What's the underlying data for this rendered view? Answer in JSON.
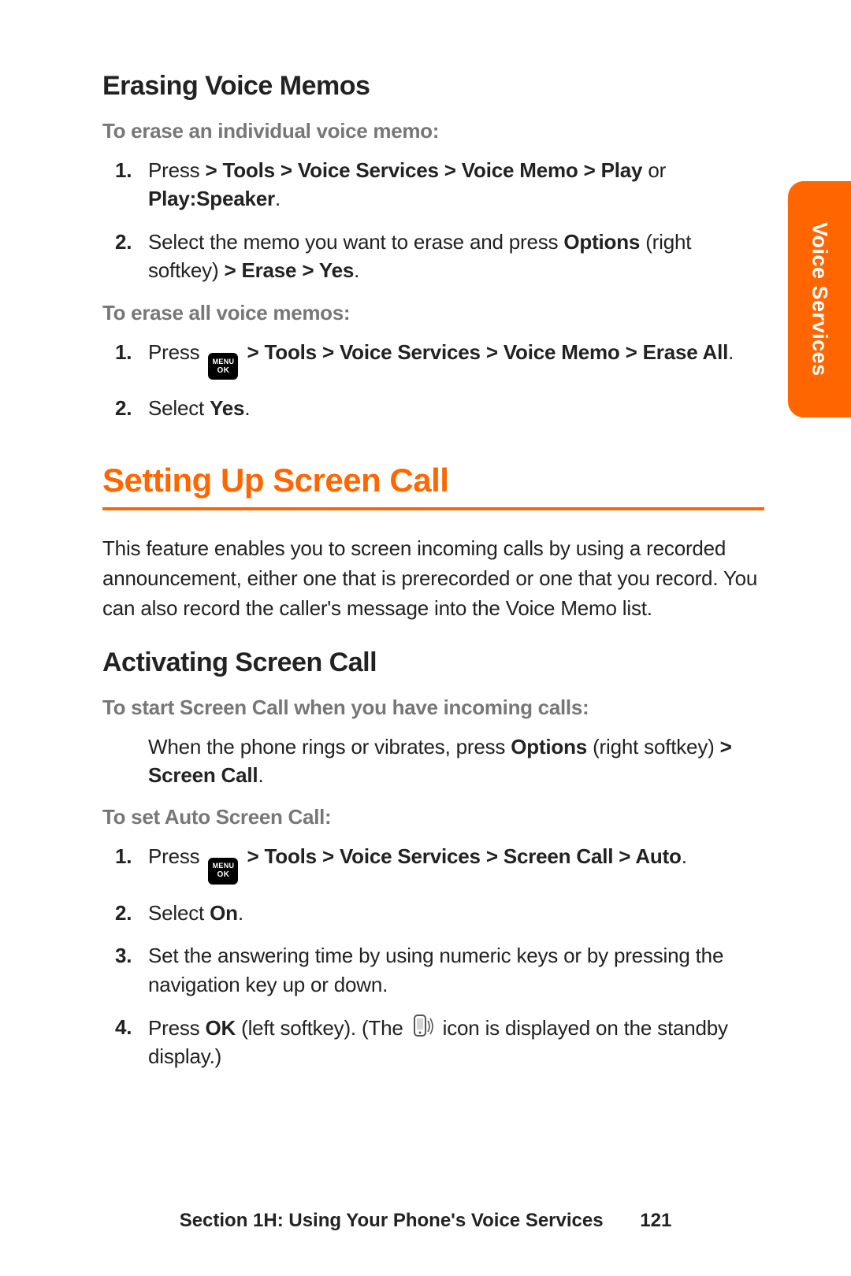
{
  "sideTab": "Voice Services",
  "h_erasing": "Erasing Voice Memos",
  "lead_erase_ind": "To erase an individual voice memo:",
  "erase_ind_steps": [
    {
      "num": "1.",
      "pre": "Press ",
      "bold1": "> Tools > Voice Services > Voice Memo > Play",
      "mid": " or ",
      "bold2": "Play:Speaker",
      "post": "."
    },
    {
      "num": "2.",
      "pre": "Select the memo you want to erase and press ",
      "bold1": "Options",
      "mid": " (right softkey) ",
      "bold2": "> Erase > Yes",
      "post": "."
    }
  ],
  "lead_erase_all": "To erase all voice memos:",
  "erase_all_steps": [
    {
      "num": "1.",
      "pre": "Press  ",
      "hasMenuIcon": true,
      "bold1": " > Tools > Voice Services > Voice Memo > Erase All",
      "post": "."
    },
    {
      "num": "2.",
      "pre": "Select ",
      "bold1": "Yes",
      "post": "."
    }
  ],
  "section_title": "Setting Up Screen Call",
  "intro": "This feature enables you to screen incoming calls by using a recorded announcement, either one that is prerecorded or one that you record. You can also record the caller's message into the Voice Memo list.",
  "h_activating": "Activating Screen Call",
  "lead_start_sc": "To start Screen Call when you have incoming calls:",
  "start_sc_body_pre": "When the phone rings or vibrates, press ",
  "start_sc_body_b1": "Options",
  "start_sc_body_mid": " (right softkey) ",
  "start_sc_body_b2": "> Screen Call",
  "start_sc_body_post": ".",
  "lead_autoset": "To set Auto Screen Call:",
  "autoset_steps": [
    {
      "num": "1.",
      "pre": "Press  ",
      "hasMenuIcon": true,
      "bold1": " > Tools > Voice Services > Screen Call > Auto",
      "post": "."
    },
    {
      "num": "2.",
      "pre": "Select ",
      "bold1": "On",
      "post": "."
    },
    {
      "num": "3.",
      "plain": "Set the answering time by using numeric keys or by pressing the navigation key up or down."
    },
    {
      "num": "4.",
      "pre": "Press ",
      "bold1": "OK",
      "mid": " (left softkey). (The  ",
      "hasPhoneIcon": true,
      "post2": "  icon is displayed on the standby display.)"
    }
  ],
  "footer_section": "Section 1H: Using Your Phone's Voice Services",
  "footer_page": "121",
  "menuIcon": {
    "line1": "MENU",
    "line2": "OK"
  }
}
